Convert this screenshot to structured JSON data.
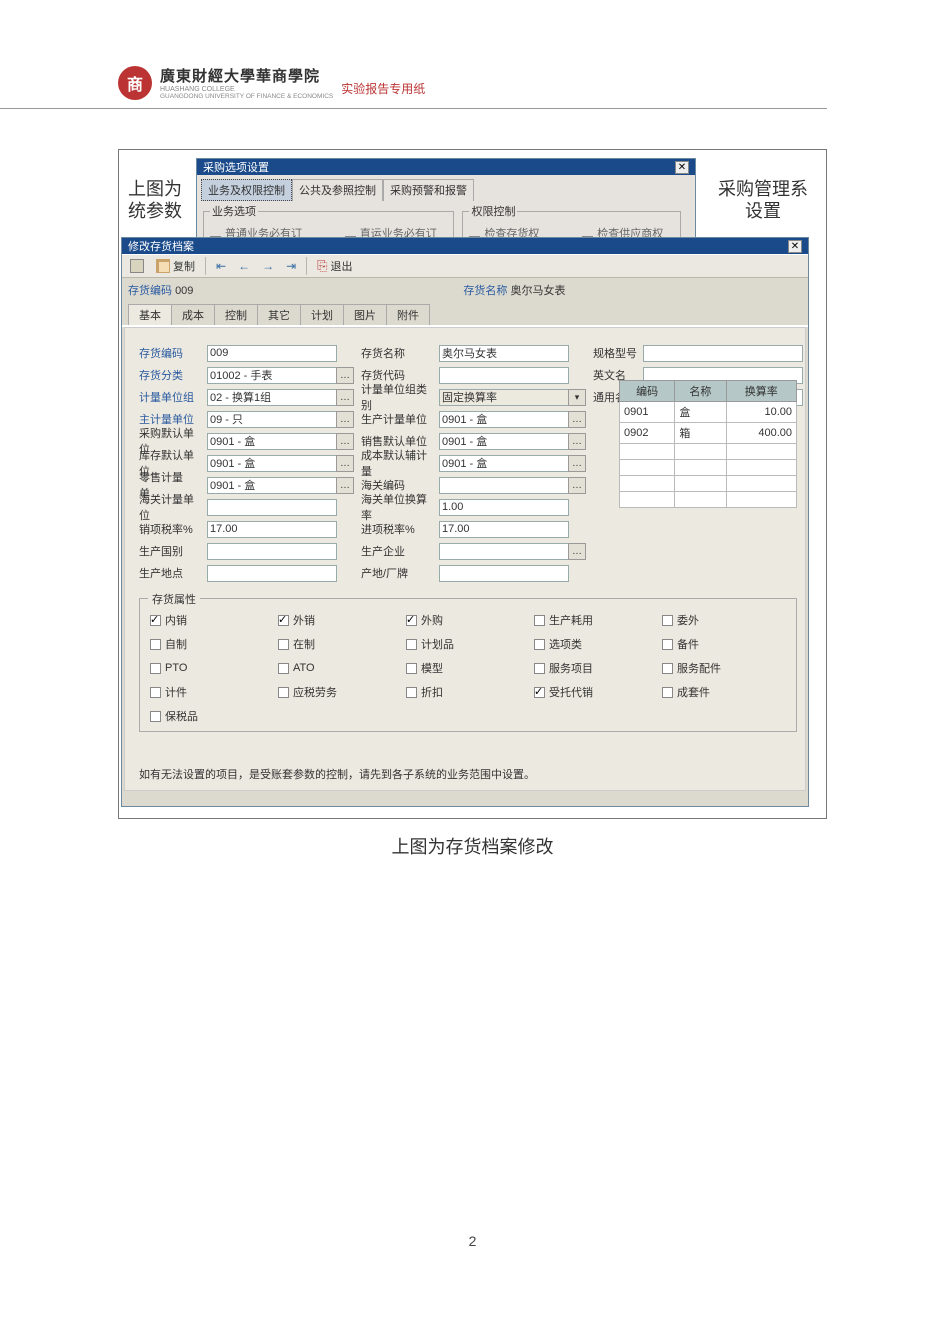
{
  "header": {
    "logo_char": "商",
    "uni_cn": "廣東財經大學華商學院",
    "uni_en1": "HUASHANG COLLEGE",
    "uni_en2": "GUANGDONG UNIVERSITY OF FINANCE & ECONOMICS",
    "paper_label": "实验报告专用纸"
  },
  "text": {
    "left1": "上图为",
    "left2": "统参数",
    "right1": "采购管理系",
    "right2": "设置"
  },
  "dlg1": {
    "title": "采购选项设置",
    "tabs": [
      "业务及权限控制",
      "公共及参照控制",
      "采购预警和报警"
    ],
    "fs1_legend": "业务选项",
    "fs1_chk": "普通业务必有订单",
    "fs1_chk2": "直运业务必有订单",
    "fs2_legend": "权限控制",
    "fs2_chk1": "检查存货权限",
    "fs2_chk2": "检查供应商权限"
  },
  "dlg2": {
    "title": "修改存货档案",
    "toolbar": {
      "copy": "复制",
      "exit": "退出"
    },
    "info": {
      "code_label": "存货编码",
      "code": "009",
      "name_label": "存货名称",
      "name": "奥尔马女表"
    },
    "tabs": [
      "基本",
      "成本",
      "控制",
      "其它",
      "计划",
      "图片",
      "附件"
    ],
    "labels": {
      "code": "存货编码",
      "name": "存货名称",
      "spec": "规格型号",
      "cat": "存货分类",
      "invcode": "存货代码",
      "enname": "英文名",
      "unitgrp": "计量单位组",
      "unitgrptype": "计量单位组类别",
      "common": "通用名称",
      "mainunit": "主计量单位",
      "produnit": "生产计量单位",
      "purunit": "采购默认单位",
      "saleunit": "销售默认单位",
      "stockunit": "库存默认单位",
      "costunit": "成本默认辅计量",
      "retailunit": "零售计量单…",
      "customs": "海关编码",
      "customsunit": "海关计量单位",
      "customsrate": "海关单位换算率",
      "outtax": "销项税率%",
      "intax": "进项税率%",
      "prodcountry": "生产国别",
      "prodcompany": "生产企业",
      "prodplace": "生产地点",
      "brand": "产地/厂牌"
    },
    "values": {
      "code": "009",
      "name": "奥尔马女表",
      "cat": "01002 - 手表",
      "unitgrp": "02 - 换算1组",
      "unitgrptype": "固定换算率",
      "mainunit": "09 - 只",
      "produnit": "0901 - 盒",
      "purunit": "0901 - 盒",
      "saleunit": "0901 - 盒",
      "stockunit": "0901 - 盒",
      "costunit": "0901 - 盒",
      "retailunit": "0901 - 盒",
      "customsrate": "1.00",
      "outtax": "17.00",
      "intax": "17.00"
    },
    "rate_table": {
      "headers": [
        "编码",
        "名称",
        "换算率"
      ],
      "rows": [
        {
          "code": "0901",
          "name": "盒",
          "rate": "10.00"
        },
        {
          "code": "0902",
          "name": "箱",
          "rate": "400.00"
        }
      ]
    },
    "attrs": {
      "legend": "存货属性",
      "items": [
        {
          "label": "内销",
          "checked": true
        },
        {
          "label": "外销",
          "checked": true
        },
        {
          "label": "外购",
          "checked": true
        },
        {
          "label": "生产耗用",
          "checked": false
        },
        {
          "label": "委外",
          "checked": false
        },
        {
          "label": "自制",
          "checked": false
        },
        {
          "label": "在制",
          "checked": false
        },
        {
          "label": "计划品",
          "checked": false
        },
        {
          "label": "选项类",
          "checked": false
        },
        {
          "label": "备件",
          "checked": false
        },
        {
          "label": "PTO",
          "checked": false
        },
        {
          "label": "ATO",
          "checked": false
        },
        {
          "label": "模型",
          "checked": false
        },
        {
          "label": "服务项目",
          "checked": false
        },
        {
          "label": "服务配件",
          "checked": false
        },
        {
          "label": "计件",
          "checked": false
        },
        {
          "label": "应税劳务",
          "checked": false
        },
        {
          "label": "折扣",
          "checked": false
        },
        {
          "label": "受托代销",
          "checked": true
        },
        {
          "label": "成套件",
          "checked": false
        },
        {
          "label": "保税品",
          "checked": false
        }
      ]
    },
    "footer": "如有无法设置的项目，是受账套参数的控制，请先到各子系统的业务范围中设置。"
  },
  "caption2": "上图为存货档案修改",
  "page_num": "2"
}
